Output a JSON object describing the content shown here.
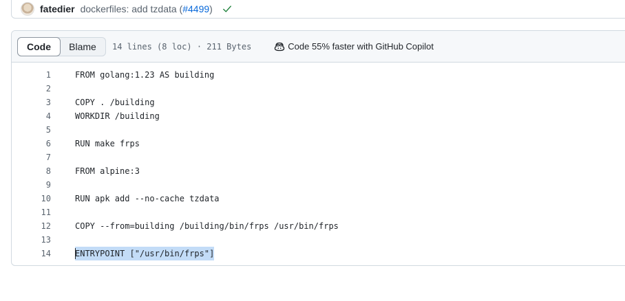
{
  "commit": {
    "author": "fatedier",
    "message": "dockerfiles: add tzdata (",
    "pr_link": "#4499",
    "message_end": ")"
  },
  "file_header": {
    "tabs": [
      {
        "label": "Code",
        "active": true
      },
      {
        "label": "Blame",
        "active": false
      }
    ],
    "meta": "14 lines (8 loc) · 211 Bytes",
    "copilot_label": "Code 55% faster with GitHub Copilot"
  },
  "code_lines": [
    {
      "num": "1",
      "text": "FROM golang:1.23 AS building"
    },
    {
      "num": "2",
      "text": ""
    },
    {
      "num": "3",
      "text": "COPY . /building"
    },
    {
      "num": "4",
      "text": "WORKDIR /building"
    },
    {
      "num": "5",
      "text": ""
    },
    {
      "num": "6",
      "text": "RUN make frps"
    },
    {
      "num": "7",
      "text": ""
    },
    {
      "num": "8",
      "text": "FROM alpine:3"
    },
    {
      "num": "9",
      "text": ""
    },
    {
      "num": "10",
      "text": "RUN apk add --no-cache tzdata"
    },
    {
      "num": "11",
      "text": ""
    },
    {
      "num": "12",
      "text": "COPY --from=building /building/bin/frps /usr/bin/frps"
    },
    {
      "num": "13",
      "text": ""
    },
    {
      "num": "14",
      "text": "ENTRYPOINT [\"/usr/bin/frps\"]"
    }
  ],
  "selected_line": "14",
  "colors": {
    "link": "#0969da",
    "check": "#1a7f37",
    "selection": "#c3dcf7"
  },
  "icons": {
    "check": "check-icon",
    "copilot": "copilot-icon",
    "avatar": "avatar"
  }
}
